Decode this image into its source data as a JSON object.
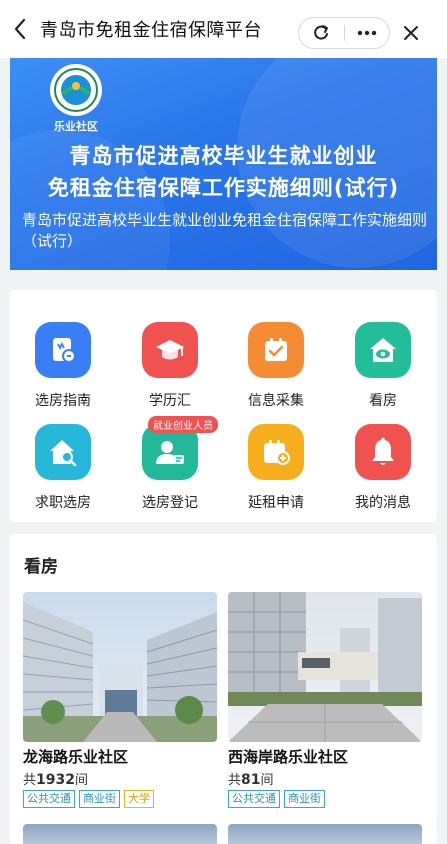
{
  "header": {
    "back_icon": "back-arrow-icon",
    "title": "青岛市免租金住宿保障平台",
    "refresh_icon": "refresh-icon",
    "more_icon": "more-icon",
    "close_icon": "close-icon"
  },
  "banner": {
    "logo_text": "乐业社区",
    "headline_line1": "青岛市促进高校毕业生就业创业",
    "headline_line2": "免租金住宿保障工作实施细则(试行)",
    "subtitle": "青岛市促进高校毕业生就业创业免租金住宿保障工作实施细则（试行）"
  },
  "menu": {
    "items": [
      {
        "label": "选房指南",
        "icon": "guide-icon",
        "color": "#3a7ef6"
      },
      {
        "label": "学历汇",
        "icon": "graduation-cap-icon",
        "color": "#f0524f"
      },
      {
        "label": "信息采集",
        "icon": "calendar-check-icon",
        "color": "#f58b33"
      },
      {
        "label": "看房",
        "icon": "house-eye-icon",
        "color": "#24bd9a"
      },
      {
        "label": "求职选房",
        "icon": "house-search-icon",
        "color": "#26b6d8"
      },
      {
        "label": "选房登记",
        "icon": "user-register-icon",
        "color": "#22b89c",
        "badge": "就业创业人员"
      },
      {
        "label": "延租申请",
        "icon": "calendar-add-icon",
        "color": "#f6ae1c"
      },
      {
        "label": "我的消息",
        "icon": "bell-icon",
        "color": "#f0524f"
      }
    ]
  },
  "housing": {
    "section_title": "看房",
    "count_prefix": "共",
    "count_suffix": "间",
    "listings": [
      {
        "name": "龙海路乐业社区",
        "count": "1932",
        "tags": [
          "公共交通",
          "商业街",
          "大学"
        ]
      },
      {
        "name": "西海岸路乐业社区",
        "count": "81",
        "tags": [
          "公共交通",
          "商业街"
        ]
      }
    ]
  }
}
